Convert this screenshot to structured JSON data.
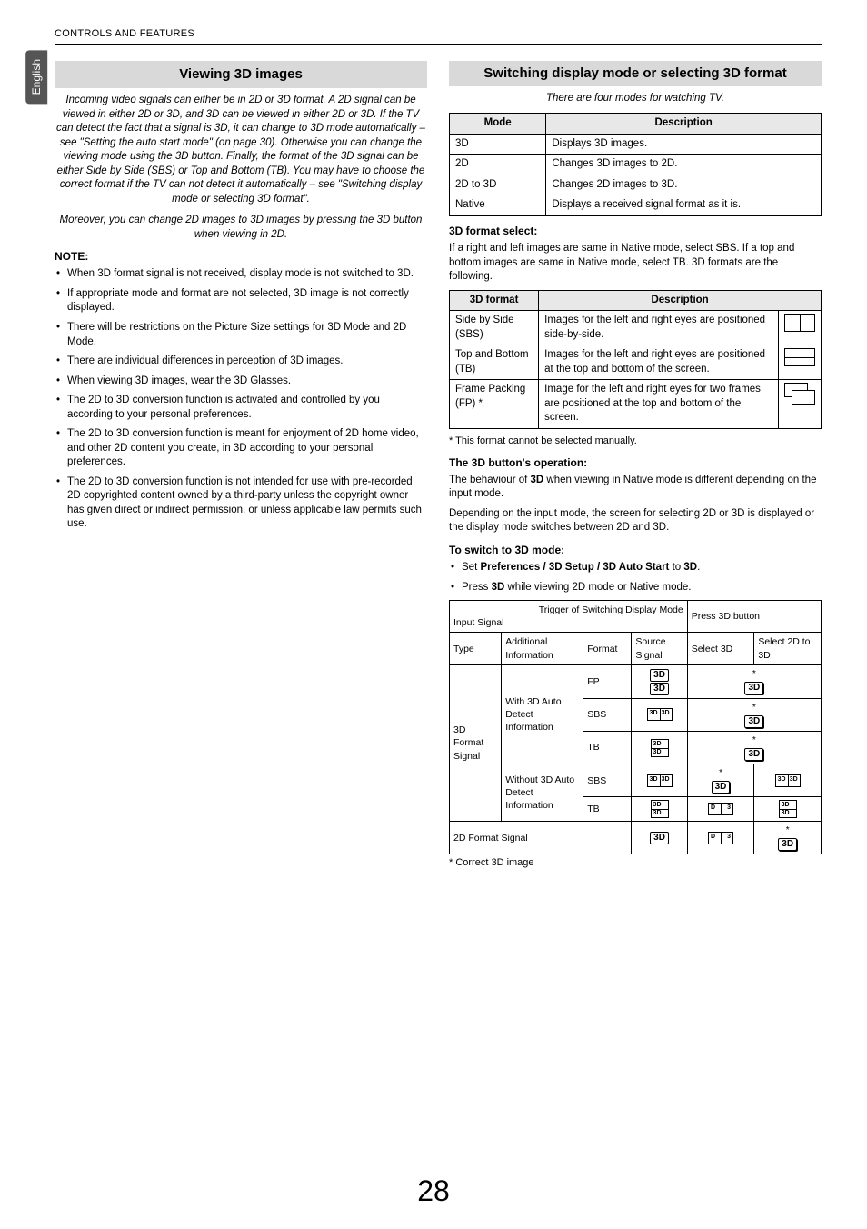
{
  "header": {
    "breadcrumb": "CONTROLS AND FEATURES"
  },
  "langTab": "English",
  "left": {
    "title": "Viewing 3D images",
    "intro": "Incoming video signals can either be in 2D or 3D format. A 2D signal can be viewed in either 2D or 3D, and 3D can be viewed in either 2D or 3D. If the TV can detect the fact that a signal is 3D, it can change to 3D mode automatically – see \"Setting the auto start mode\" (on page 30). Otherwise you can change the viewing mode using the 3D button. Finally, the format of the 3D signal can be either Side by Side (SBS) or Top and Bottom (TB). You may have to choose the correct format if the TV can not detect it automatically – see \"Switching display mode or selecting 3D format\".",
    "intro2": "Moreover, you can change 2D images to 3D images by pressing the 3D button when viewing in 2D.",
    "noteHead": "NOTE:",
    "notes": [
      "When 3D format signal is not received, display mode is not switched to 3D.",
      "If appropriate mode and format are not selected, 3D image is not correctly displayed.",
      "There will be restrictions on the Picture Size settings for 3D Mode and 2D Mode.",
      "There are individual differences in perception of 3D images.",
      "When viewing 3D images, wear the 3D Glasses.",
      "The 2D to 3D conversion function is activated and controlled by you according to your personal preferences.",
      "The 2D to 3D conversion function is meant for enjoyment of 2D home video, and other 2D content you create, in 3D according to your personal preferences.",
      "The 2D to 3D conversion function is not intended for use with pre-recorded 2D copyrighted content owned by a third-party unless the copyright owner has given direct or indirect permission, or unless applicable law permits such use."
    ]
  },
  "right": {
    "title": "Switching display mode or selecting 3D format",
    "intro": "There are four modes for watching TV.",
    "modeTable": {
      "headers": [
        "Mode",
        "Description"
      ],
      "rows": [
        [
          "3D",
          "Displays 3D images."
        ],
        [
          "2D",
          "Changes 3D images to 2D."
        ],
        [
          "2D to 3D",
          "Changes 2D images to 3D."
        ],
        [
          "Native",
          "Displays a received signal format as it is."
        ]
      ]
    },
    "fmtSelectHead": "3D format select:",
    "fmtSelectBody": "If a right and left images are same in Native mode, select SBS. If a top and bottom images are same in Native mode, select TB. 3D formats are the following.",
    "fmtTable": {
      "headers": [
        "3D format",
        "Description"
      ],
      "rows": [
        {
          "name": "Side by Side (SBS)",
          "desc": "Images for the left and right eyes are positioned side-by-side.",
          "icon": "sbs"
        },
        {
          "name": "Top and Bottom (TB)",
          "desc": "Images for the left and right eyes are positioned at the top and bottom of the screen.",
          "icon": "tb"
        },
        {
          "name": "Frame Packing (FP) *",
          "desc": "Image for the left and right eyes for two frames are positioned at the top and bottom of the screen.",
          "icon": "fp"
        }
      ]
    },
    "fmtFootnote": "*  This format cannot be selected manually.",
    "btnHead": "The 3D button's operation:",
    "btnBody1": "The behaviour of 3D when viewing in Native mode is different depending on the input mode.",
    "btnBody1_pre": "The behaviour of ",
    "btnBody1_bold": "3D",
    "btnBody1_post": " when viewing in Native mode is different depending on the input mode.",
    "btnBody2": "Depending on the input mode, the screen for selecting 2D or 3D is displayed or the display mode switches between 2D and 3D.",
    "switchHead": "To switch to 3D mode:",
    "switchItems": [
      {
        "pre": "Set ",
        "bold": "Preferences / 3D Setup / 3D Auto Start",
        "mid": " to ",
        "bold2": "3D",
        "post": "."
      },
      {
        "pre": "Press ",
        "bold": "3D",
        "post": " while viewing 2D mode or Native mode."
      }
    ],
    "complexTable": {
      "triggerHead": "Trigger of Switching Display Mode",
      "pressHead": "Press 3D button",
      "inputSignal": "Input Signal",
      "cols": {
        "type": "Type",
        "addl": "Additional Information",
        "format": "Format",
        "source": "Source Signal",
        "sel3d": "Select 3D",
        "sel2dto3d": "Select 2D to 3D"
      },
      "group3d": "3D Format Signal",
      "withAD": "With 3D Auto Detect Information",
      "withoutAD": "Without 3D Auto Detect Information",
      "row2d": "2D Format Signal",
      "fmt": {
        "fp": "FP",
        "sbs": "SBS",
        "tb": "TB"
      }
    },
    "complexFootnote": "*  Correct 3D image"
  },
  "pageNumber": "28"
}
